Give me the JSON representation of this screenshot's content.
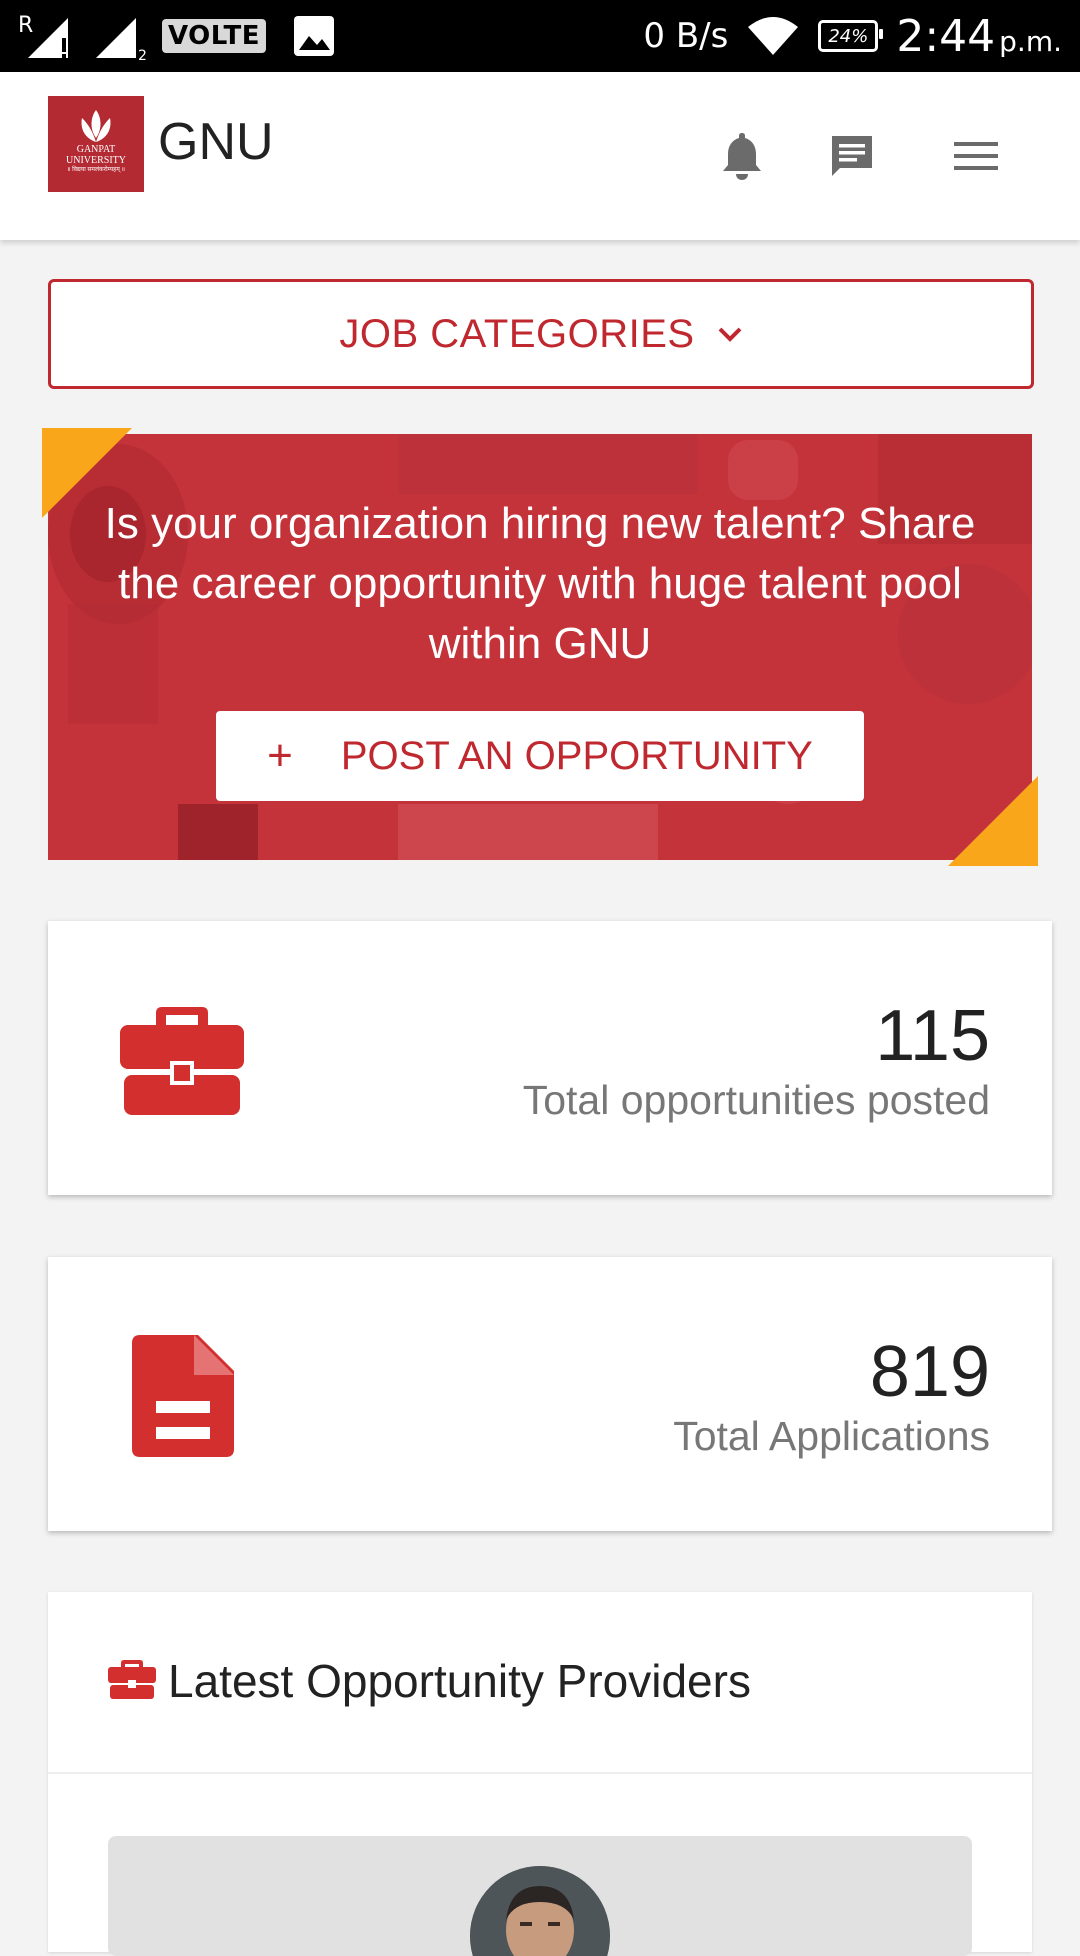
{
  "status_bar": {
    "sim_label": "R",
    "volte": "VOLTE",
    "data_speed": "0 B/s",
    "battery": "24%",
    "time": "2:44",
    "time_suffix": "p.m."
  },
  "header": {
    "logo_lines": [
      "GANPAT",
      "UNIVERSITY"
    ],
    "logo_tagline": "॥ विद्यया समलंकरोम्यहम् ॥",
    "title": "GNU",
    "icons": [
      "bell-icon",
      "chat-icon",
      "menu-icon"
    ]
  },
  "job_categories": {
    "label": "JOB CATEGORIES",
    "icon": "chevron-down-icon"
  },
  "banner": {
    "text": "Is your organization hiring new talent? Share the career opportunity with huge talent pool within GNU",
    "button_plus": "+",
    "button_label": "POST AN OPPORTUNITY",
    "corner_color": "#f9a61a"
  },
  "stats": [
    {
      "value": "115",
      "label": "Total opportunities posted",
      "icon": "briefcase-icon"
    },
    {
      "value": "819",
      "label": "Total Applications",
      "icon": "document-icon"
    }
  ],
  "providers": {
    "title": "Latest Opportunity Providers",
    "icon": "briefcase-icon"
  },
  "colors": {
    "brand_red": "#c0282f",
    "accent": "#f9a61a"
  }
}
